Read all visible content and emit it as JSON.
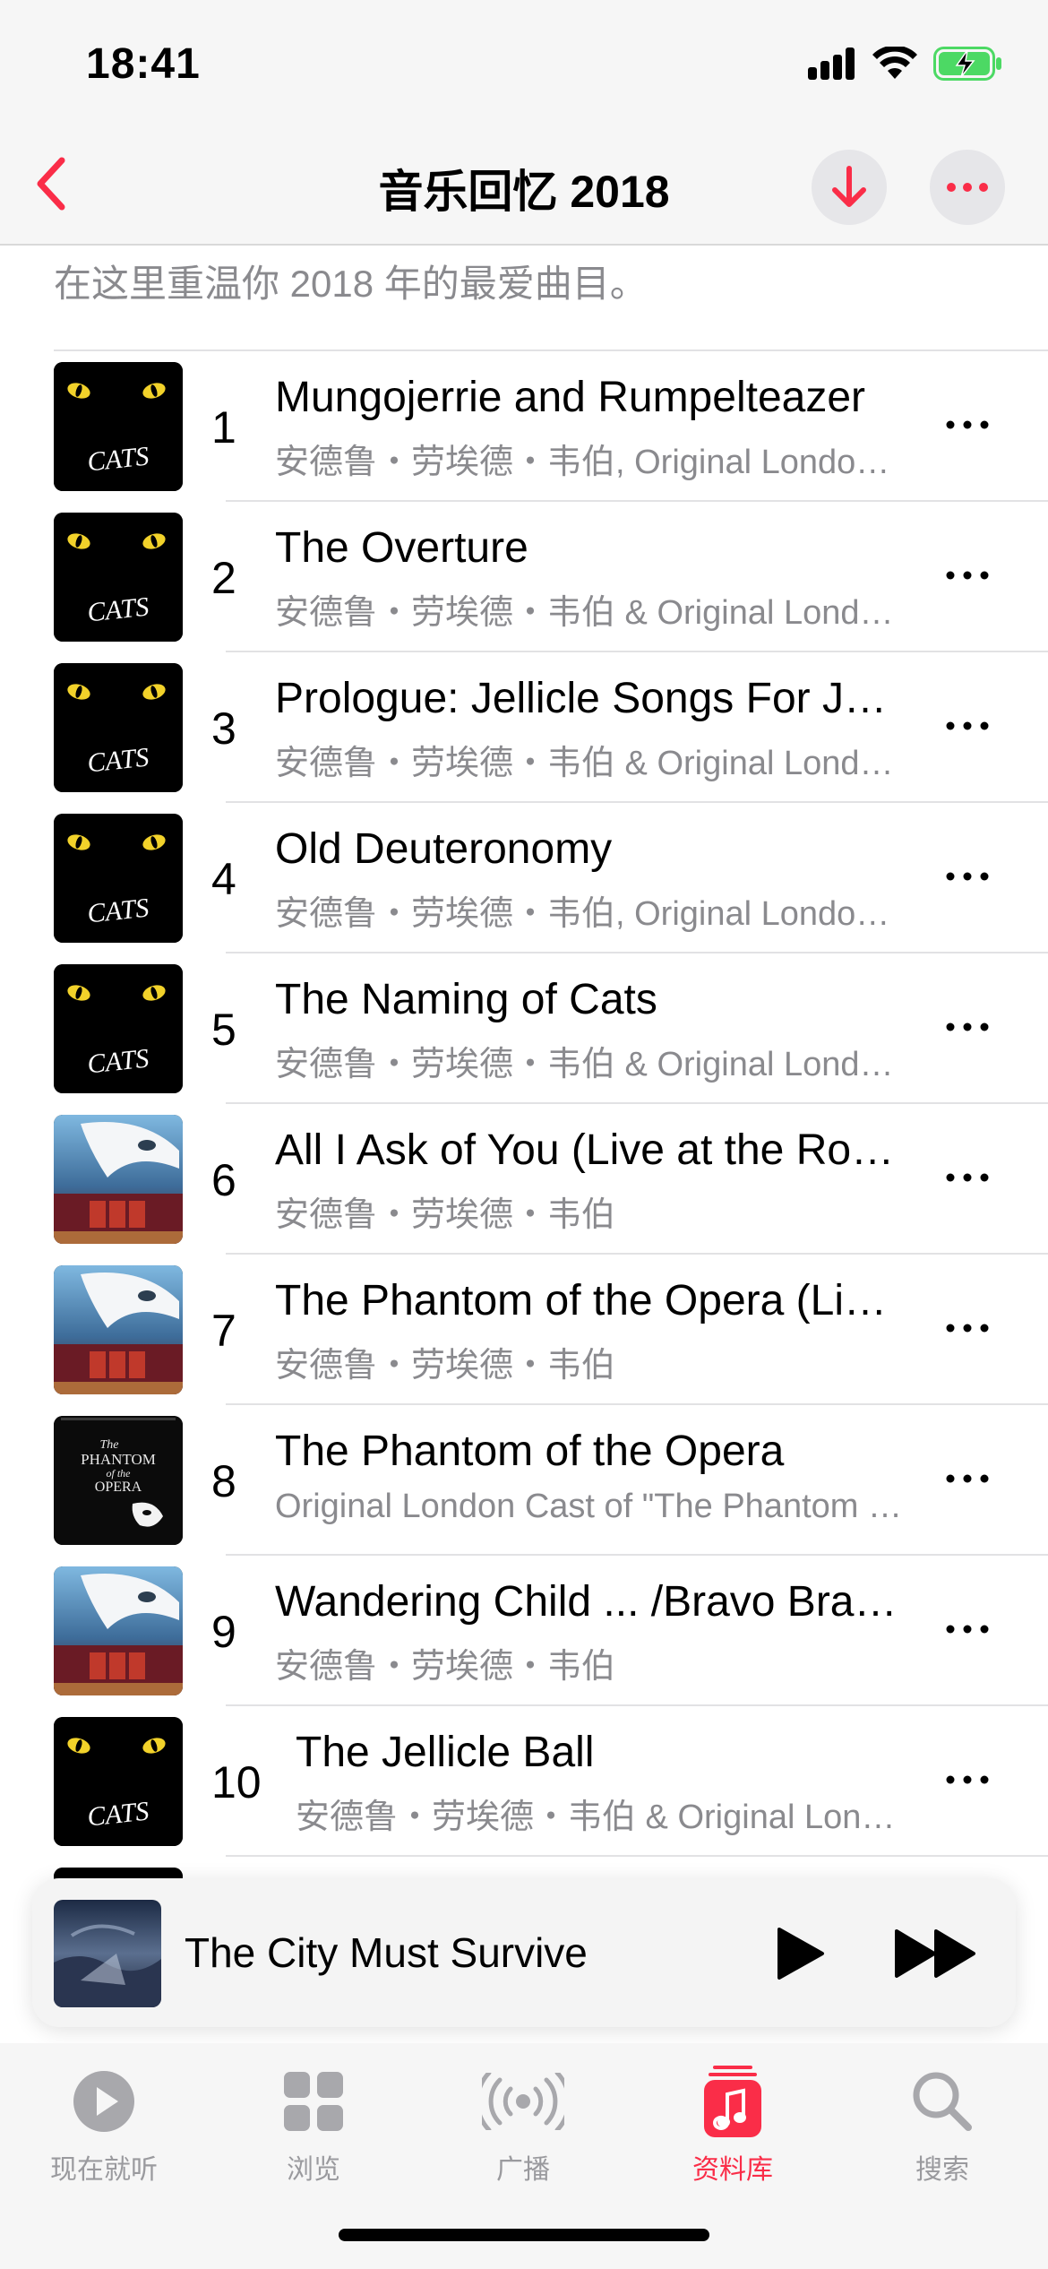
{
  "status_bar": {
    "time": "18:41"
  },
  "nav": {
    "title": "音乐回忆 2018"
  },
  "description": "在这里重温你 2018 年的最爱曲目。",
  "tracks": [
    {
      "number": "1",
      "title": "Mungojerrie and Rumpelteazer",
      "artist": "安德鲁・劳埃德・韦伯, Original London Cast of \"Cats\"",
      "art": "cats"
    },
    {
      "number": "2",
      "title": "The Overture",
      "artist": "安德鲁・劳埃德・韦伯 & Original London Cast of \"Cats\"",
      "art": "cats"
    },
    {
      "number": "3",
      "title": "Prologue: Jellicle Songs For Jellicle Cats",
      "artist": "安德鲁・劳埃德・韦伯 & Original London Cast of \"Cats\"",
      "art": "cats"
    },
    {
      "number": "4",
      "title": "Old Deuteronomy",
      "artist": "安德鲁・劳埃德・韦伯, Original London Cast of \"Cats\"",
      "art": "cats"
    },
    {
      "number": "5",
      "title": "The Naming of Cats",
      "artist": "安德鲁・劳埃德・韦伯 & Original London Cast of \"Cats\"",
      "art": "cats"
    },
    {
      "number": "6",
      "title": "All I Ask of You (Live at the Royal Albert Hall)",
      "artist": "安德鲁・劳埃德・韦伯",
      "art": "phantom-live"
    },
    {
      "number": "7",
      "title": "The Phantom of the Opera (Live)",
      "artist": "安德鲁・劳埃德・韦伯",
      "art": "phantom-live"
    },
    {
      "number": "8",
      "title": "The Phantom of the Opera",
      "artist": "Original London Cast of \"The Phantom of the Opera\"",
      "art": "phantom-black"
    },
    {
      "number": "9",
      "title": "Wandering Child ... /Bravo Bravissimo",
      "artist": "安德鲁・劳埃德・韦伯",
      "art": "phantom-live"
    },
    {
      "number": "10",
      "title": "The Jellicle Ball",
      "artist": "安德鲁・劳埃德・韦伯 & Original London Cast of \"Cats\"",
      "art": "cats"
    }
  ],
  "cats_art_label": "CATS",
  "phantom_art_label": [
    "The",
    "PHANTOM",
    "of the",
    "OPERA"
  ],
  "mini_player": {
    "title": "The City Must Survive"
  },
  "tabs": [
    {
      "label": "现在就听",
      "icon": "play-circle-icon",
      "active": false
    },
    {
      "label": "浏览",
      "icon": "grid-icon",
      "active": false
    },
    {
      "label": "广播",
      "icon": "radio-icon",
      "active": false
    },
    {
      "label": "资料库",
      "icon": "music-library-icon",
      "active": true
    },
    {
      "label": "搜索",
      "icon": "search-icon",
      "active": false
    }
  ],
  "colors": {
    "accent": "#fa2d48",
    "secondary_text": "#8a8a8e",
    "inactive_tab": "#9a9a9e"
  }
}
